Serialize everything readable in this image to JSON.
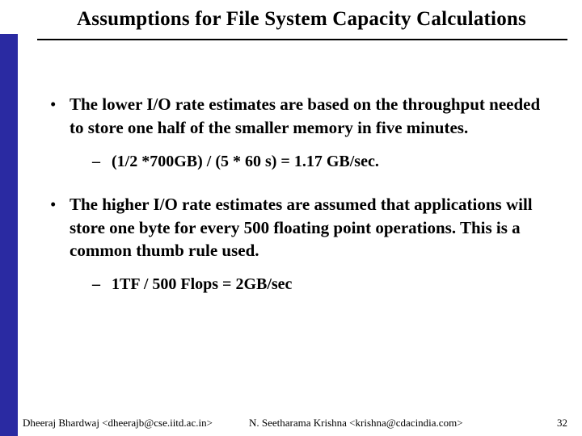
{
  "title": "Assumptions for  File System Capacity Calculations",
  "bullets": [
    {
      "text": "The lower I/O rate estimates are based on the throughput needed to store one half of the smaller memory in five minutes.",
      "sub": "(1/2 *700GB) /  (5 * 60 s) =   1.17 GB/sec."
    },
    {
      "text": "The higher I/O rate estimates are assumed that applications will store one byte for every 500 floating point operations. This is a common thumb rule used.",
      "sub": "1TF / 500 Flops = 2GB/sec"
    }
  ],
  "footer": {
    "author_left": "Dheeraj Bhardwaj <dheerajb@cse.iitd.ac.in>",
    "author_right": "N. Seetharama Krishna <krishna@cdacindia.com>",
    "page": "32"
  },
  "marks": {
    "bullet": "•",
    "dash": "–"
  }
}
